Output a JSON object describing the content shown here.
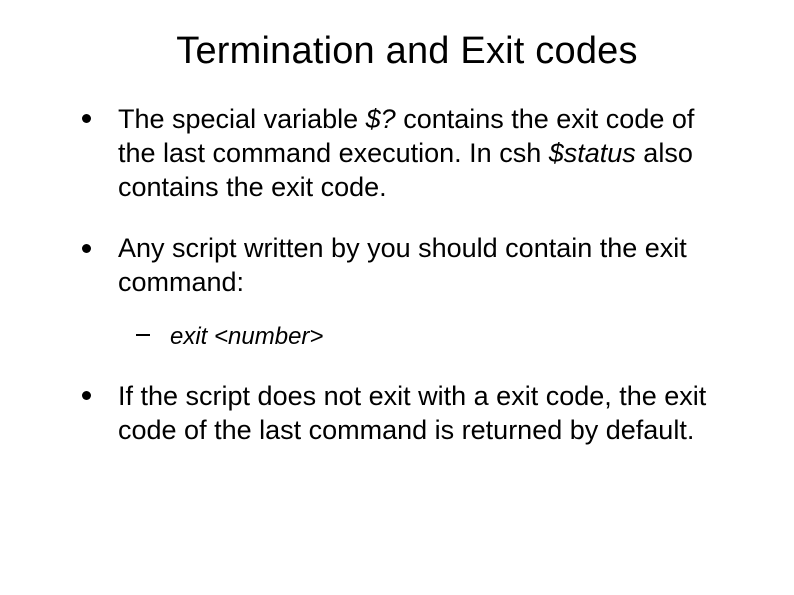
{
  "slide": {
    "title": "Termination and Exit codes",
    "bullets": [
      {
        "pre": "The special variable ",
        "em1": "$?",
        "mid": " contains the exit code of the last command execution. In csh ",
        "em2": "$status",
        "post": " also contains the exit code."
      },
      {
        "text": "Any script written by you should contain the exit command:",
        "sub": [
          {
            "text_italic": "exit <number>"
          }
        ]
      },
      {
        "text": "If the script does not exit with a exit code, the exit code of the last command is returned by default."
      }
    ]
  }
}
